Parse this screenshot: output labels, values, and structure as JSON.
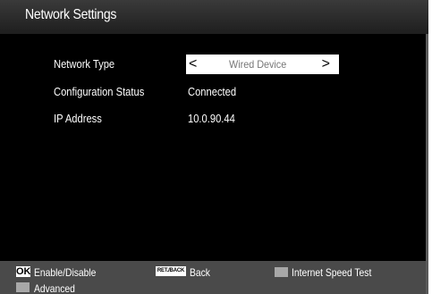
{
  "window": {
    "title": "Network Settings"
  },
  "settings": {
    "network_type": {
      "label": "Network Type",
      "value": "Wired Device",
      "left_arrow": "<",
      "right_arrow": ">"
    },
    "configuration_status": {
      "label": "Configuration Status",
      "value": "Connected"
    },
    "ip_address": {
      "label": "IP Address",
      "value": "10.0.90.44"
    }
  },
  "footer": {
    "ok_key": "OK",
    "ok_label": "Enable/Disable",
    "back_key": "RET./BACK",
    "back_label": "Back",
    "speed_test_label": "Internet Speed Test",
    "advanced_label": "Advanced"
  },
  "colors": {
    "background": "#000000",
    "header": "#2e2e2e",
    "footer": "#4a4a4a",
    "selector": "#ffffff",
    "selector_text": "#777777"
  }
}
